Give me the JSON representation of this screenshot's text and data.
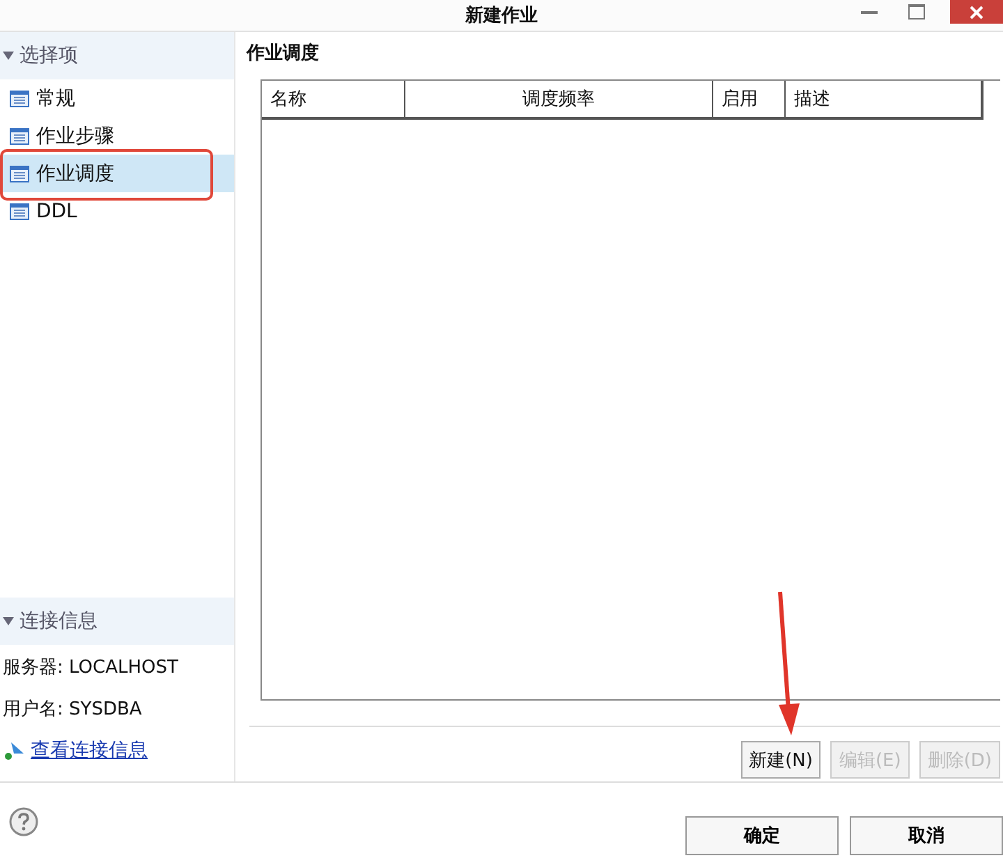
{
  "window": {
    "title": "新建作业"
  },
  "sidebar": {
    "options": {
      "header": "选择项",
      "expanded": true,
      "items": [
        {
          "label": "常规",
          "selected": false
        },
        {
          "label": "作业步骤",
          "selected": false
        },
        {
          "label": "作业调度",
          "selected": true
        },
        {
          "label": "DDL",
          "selected": false
        }
      ]
    },
    "connection": {
      "header": "连接信息",
      "expanded": true,
      "rows": [
        "服务器: LOCALHOST",
        "用户名: SYSDBA"
      ],
      "link": "查看连接信息"
    }
  },
  "panel": {
    "title": "作业调度",
    "table": {
      "columns": [
        "名称",
        "调度频率",
        "启用",
        "描述"
      ]
    },
    "buttons": [
      {
        "label": "新建(N)",
        "disabled": false
      },
      {
        "label": "编辑(E)",
        "disabled": true
      },
      {
        "label": "删除(D)",
        "disabled": true
      }
    ]
  },
  "footer": {
    "buttons": [
      "确定",
      "取消"
    ]
  }
}
